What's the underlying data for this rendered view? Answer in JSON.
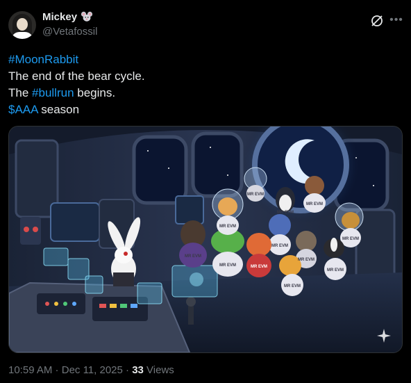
{
  "author": {
    "display_name": "Mickey",
    "name_emoji_icon": "mouse-face-icon",
    "handle": "@Vetafossil"
  },
  "header_actions": {
    "grok_icon": "grok-icon",
    "more_icon": "more-horizontal-icon"
  },
  "tweet": {
    "hashtag_1": "#MoonRabbit",
    "line_2": "The end of the bear cycle.",
    "line_3_prefix": "The ",
    "hashtag_2": "#bullrun",
    "line_3_suffix": " begins.",
    "cashtag": "$AAA",
    "line_4_suffix": " season"
  },
  "media": {
    "description_labels": [
      "MR EVM",
      "MR EVM",
      "MR EVM",
      "MR EVM",
      "MR EVM",
      "MR EVM",
      "MR EVM",
      "MR EVM",
      "MR EVM",
      "MR EVM",
      "MR EVM",
      "MR EVM"
    ],
    "accent_colors": {
      "moon": "#cfe6ff",
      "hologram": "#5fd0ff",
      "hull": "#2a3550"
    }
  },
  "footer": {
    "time": "10:59 AM",
    "separator": " · ",
    "date": "Dec 11, 2025",
    "separator_2": " · ",
    "views_count": "33",
    "views_label": " Views"
  },
  "colors": {
    "link": "#1d9bf0",
    "text": "#e7e9ea",
    "muted": "#71767b",
    "background": "#000000"
  }
}
